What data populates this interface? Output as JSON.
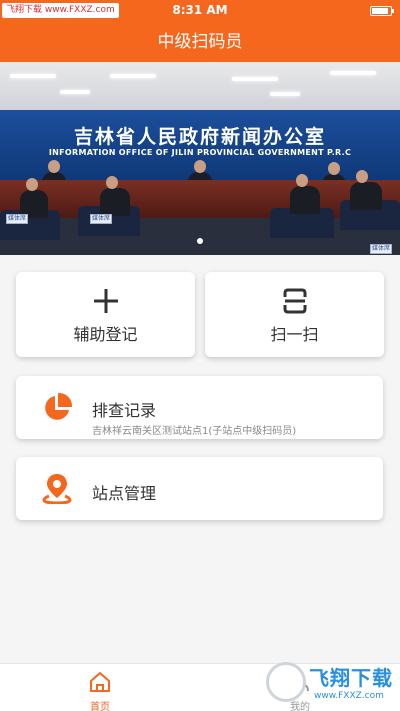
{
  "status_bar": {
    "watermark": "飞翔下载 www.FXXZ.com",
    "time": "8:31 AM"
  },
  "nav": {
    "title": "中级扫码员"
  },
  "banner": {
    "wall_title": "吉林省人民政府新闻办公室",
    "wall_subtitle": "INFORMATION OFFICE OF JILIN PROVINCIAL GOVERNMENT P.R.C",
    "seat_sign": "媒体席"
  },
  "actions": {
    "register": {
      "label": "辅助登记",
      "icon": "plus-icon"
    },
    "scan": {
      "label": "扫一扫",
      "icon": "scan-icon"
    }
  },
  "menu": {
    "records": {
      "title": "排查记录",
      "subtitle": "吉林祥云南关区测试站点1(子站点中级扫码员)",
      "icon": "pie-chart-icon"
    },
    "stations": {
      "title": "站点管理",
      "icon": "location-pin-icon"
    }
  },
  "tabs": [
    {
      "label": "首页",
      "icon": "home-icon",
      "active": true
    },
    {
      "label": "我的",
      "icon": "user-icon",
      "active": false
    }
  ],
  "watermark": {
    "brand": "飞翔下载",
    "url": "www.FXXZ.com"
  },
  "colors": {
    "primary": "#f6671e",
    "text": "#333333",
    "muted": "#888888"
  }
}
